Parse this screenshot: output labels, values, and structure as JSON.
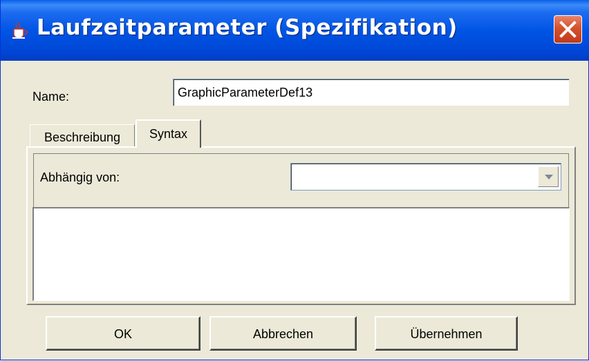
{
  "window": {
    "title": "Laufzeitparameter (Spezifikation)",
    "icon": "java-coffee-cup-icon",
    "close_icon": "close-icon"
  },
  "form": {
    "name_label": "Name:",
    "name_value": "GraphicParameterDef13"
  },
  "tabs": [
    {
      "label": "Beschreibung",
      "active": false
    },
    {
      "label": "Syntax",
      "active": true
    }
  ],
  "syntax_panel": {
    "dependency_label": "Abhängig von:",
    "dependency_value": "",
    "dropdown_icon": "chevron-down-icon"
  },
  "buttons": {
    "ok": "OK",
    "cancel": "Abbrechen",
    "apply": "Übernehmen"
  },
  "colors": {
    "titlebar": "#0055E5",
    "window_bg": "#ECE9D8",
    "close_button": "#D4522D"
  }
}
